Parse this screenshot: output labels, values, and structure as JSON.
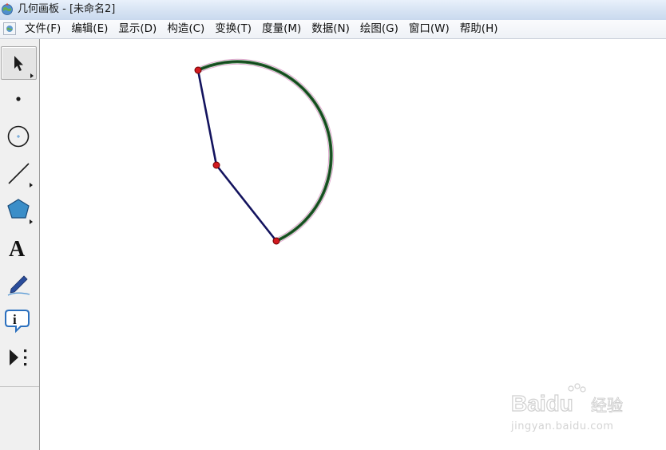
{
  "window": {
    "title": "几何画板 - [未命名2]",
    "app_icon": "globe-icon"
  },
  "menubar": {
    "doc_icon": "document-icon",
    "items": [
      "文件(F)",
      "编辑(E)",
      "显示(D)",
      "构造(C)",
      "变换(T)",
      "度量(M)",
      "数据(N)",
      "绘图(G)",
      "窗口(W)",
      "帮助(H)"
    ]
  },
  "toolbox": {
    "tools": [
      {
        "name": "arrow-tool",
        "icon": "arrow-cursor-icon",
        "selected": true
      },
      {
        "name": "point-tool",
        "icon": "point-icon"
      },
      {
        "name": "compass-tool",
        "icon": "circle-icon"
      },
      {
        "name": "straightedge-tool",
        "icon": "line-segment-icon"
      },
      {
        "name": "polygon-tool",
        "icon": "pentagon-icon"
      },
      {
        "name": "text-tool",
        "icon": "text-a-icon",
        "label": "A"
      },
      {
        "name": "marker-tool",
        "icon": "marker-pen-icon"
      },
      {
        "name": "information-tool",
        "icon": "info-icon",
        "label": "i"
      },
      {
        "name": "custom-tools",
        "icon": "play-more-icon"
      }
    ]
  },
  "colors": {
    "segment": "#13135e",
    "point_fill": "#d2191f",
    "arc_highlight": "#2b6a35",
    "arc_outline": "#e0a8ce",
    "polygon_fill": "#3b8ec8"
  },
  "watermark": {
    "brand": "Baidu",
    "brand_cn": "经验",
    "url": "jingyan.baidu.com"
  }
}
